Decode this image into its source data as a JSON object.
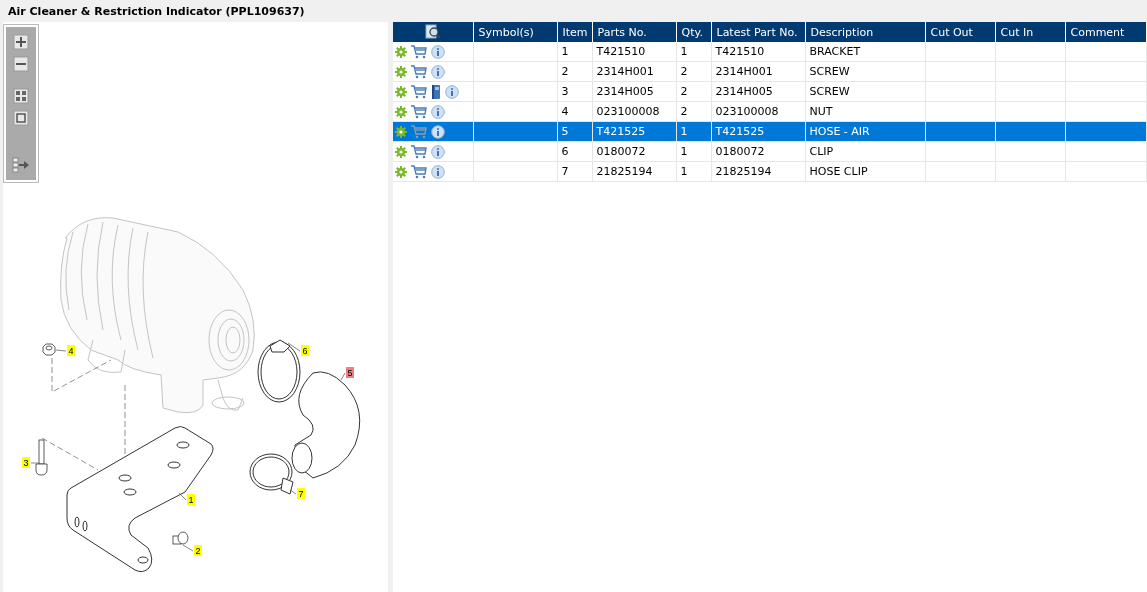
{
  "title": "Air Cleaner & Restriction Indicator (PPL109637)",
  "diagram": {
    "callouts": [
      {
        "label": "1",
        "selected": false
      },
      {
        "label": "2",
        "selected": false
      },
      {
        "label": "3",
        "selected": false
      },
      {
        "label": "4",
        "selected": false
      },
      {
        "label": "5",
        "selected": true
      },
      {
        "label": "6",
        "selected": false
      },
      {
        "label": "7",
        "selected": false
      }
    ]
  },
  "table": {
    "columns": [
      "Symbol(s)",
      "Item",
      "Parts No.",
      "Qty.",
      "Latest Part No.",
      "Description",
      "Cut Out",
      "Cut In",
      "Comment"
    ],
    "rows": [
      {
        "icons": [
          {
            "kind": "gear"
          },
          {
            "kind": "cart"
          },
          {
            "kind": "info"
          }
        ],
        "item": "1",
        "part_no": "T421510",
        "qty": "1",
        "latest_part_no": "T421510",
        "description": "BRACKET",
        "selected": false
      },
      {
        "icons": [
          {
            "kind": "gear"
          },
          {
            "kind": "cart"
          },
          {
            "kind": "info"
          }
        ],
        "item": "2",
        "part_no": "2314H001",
        "qty": "2",
        "latest_part_no": "2314H001",
        "description": "SCREW",
        "selected": false
      },
      {
        "icons": [
          {
            "kind": "gear"
          },
          {
            "kind": "cart"
          },
          {
            "kind": "book"
          },
          {
            "kind": "info"
          }
        ],
        "item": "3",
        "part_no": "2314H005",
        "qty": "2",
        "latest_part_no": "2314H005",
        "description": "SCREW",
        "selected": false
      },
      {
        "icons": [
          {
            "kind": "gear"
          },
          {
            "kind": "cart"
          },
          {
            "kind": "info"
          }
        ],
        "item": "4",
        "part_no": "023100008",
        "qty": "2",
        "latest_part_no": "023100008",
        "description": "NUT",
        "selected": false
      },
      {
        "icons": [
          {
            "kind": "gear"
          },
          {
            "kind": "cart"
          },
          {
            "kind": "info"
          }
        ],
        "item": "5",
        "part_no": "T421525",
        "qty": "1",
        "latest_part_no": "T421525",
        "description": "HOSE - AIR",
        "selected": true
      },
      {
        "icons": [
          {
            "kind": "gear"
          },
          {
            "kind": "cart"
          },
          {
            "kind": "info"
          }
        ],
        "item": "6",
        "part_no": "0180072",
        "qty": "1",
        "latest_part_no": "0180072",
        "description": "CLIP",
        "selected": false
      },
      {
        "icons": [
          {
            "kind": "gear"
          },
          {
            "kind": "cart"
          },
          {
            "kind": "info"
          }
        ],
        "item": "7",
        "part_no": "21825194",
        "qty": "1",
        "latest_part_no": "21825194",
        "description": "HOSE CLIP",
        "selected": false
      }
    ]
  }
}
